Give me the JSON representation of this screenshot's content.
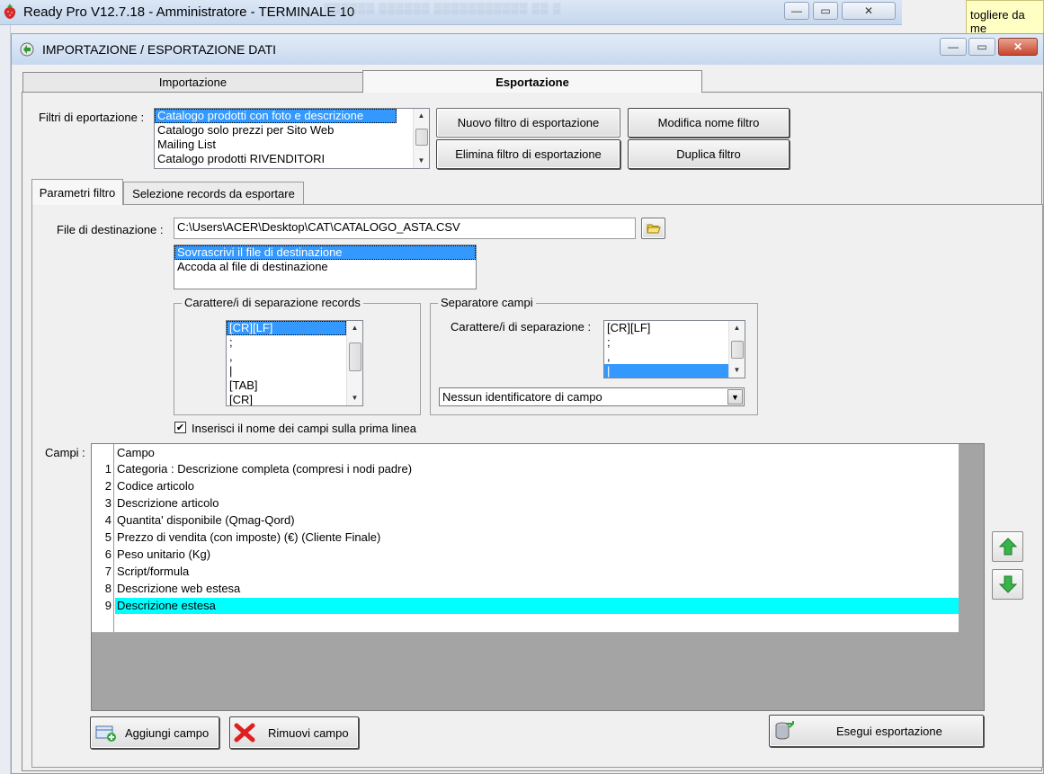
{
  "background_window": {
    "title": "Ready Pro V12.7.18 - Amministratore - TERMINALE 10",
    "note_text": "togliere da me"
  },
  "dialog": {
    "title": "IMPORTAZIONE / ESPORTAZIONE DATI",
    "tabs": [
      {
        "label": "Importazione",
        "active": false
      },
      {
        "label": "Esportazione",
        "active": true
      }
    ],
    "filters": {
      "label": "Filtri di eportazione :",
      "items": [
        "Catalogo prodotti con foto e descrizione",
        "Catalogo solo prezzi per Sito Web",
        "Mailing List",
        "Catalogo prodotti RIVENDITORI"
      ],
      "selected_index": 0
    },
    "buttons": {
      "new_filter": "Nuovo filtro di esportazione",
      "rename_filter": "Modifica nome filtro",
      "delete_filter": "Elimina filtro di esportazione",
      "duplicate_filter": "Duplica filtro"
    },
    "inner_tabs": [
      {
        "label": "Parametri filtro",
        "active": true
      },
      {
        "label": "Selezione records da esportare",
        "active": false
      }
    ],
    "destination": {
      "label": "File di destinazione :",
      "value": "C:\\Users\\ACER\\Desktop\\CAT\\CATALOGO_ASTA.CSV",
      "modes": [
        "Sovrascrivi il file di destinazione",
        "Accoda al file di destinazione"
      ],
      "selected_mode": 0
    },
    "record_separator": {
      "title": "Carattere/i di separazione records",
      "items": [
        "[CR][LF]",
        ";",
        ",",
        "|",
        "[TAB]",
        "[CR]"
      ],
      "selected_index": 0
    },
    "field_separator": {
      "title": "Separatore campi",
      "label": "Carattere/i di separazione :",
      "items": [
        "[CR][LF]",
        ";",
        ",",
        "|"
      ],
      "selected_index": 3,
      "identifier": "Nessun identificatore di campo"
    },
    "header_checkbox": {
      "label": "Inserisci il nome dei campi sulla prima linea",
      "checked": true
    },
    "fields": {
      "label": "Campi :",
      "column_header": "Campo",
      "rows": [
        {
          "n": "1",
          "campo": "Categoria : Descrizione completa (compresi i nodi padre)"
        },
        {
          "n": "2",
          "campo": "Codice articolo"
        },
        {
          "n": "3",
          "campo": "Descrizione articolo"
        },
        {
          "n": "4",
          "campo": "Quantita' disponibile (Qmag-Qord)"
        },
        {
          "n": "5",
          "campo": "Prezzo di vendita (con imposte) (€) (Cliente Finale)"
        },
        {
          "n": "6",
          "campo": "Peso unitario (Kg)"
        },
        {
          "n": "7",
          "campo": "Script/formula"
        },
        {
          "n": "8",
          "campo": "Descrizione web estesa"
        },
        {
          "n": "9",
          "campo": "Descrizione estesa"
        }
      ],
      "highlighted_row": 8
    },
    "bottom_buttons": {
      "add_field": "Aggiungi campo",
      "remove_field": "Rimuovi campo",
      "run_export": "Esegui esportazione"
    },
    "colors": {
      "selection": "#3399ff",
      "row_highlight": "#00ffff",
      "arrow_green": "#2fa83a"
    }
  }
}
